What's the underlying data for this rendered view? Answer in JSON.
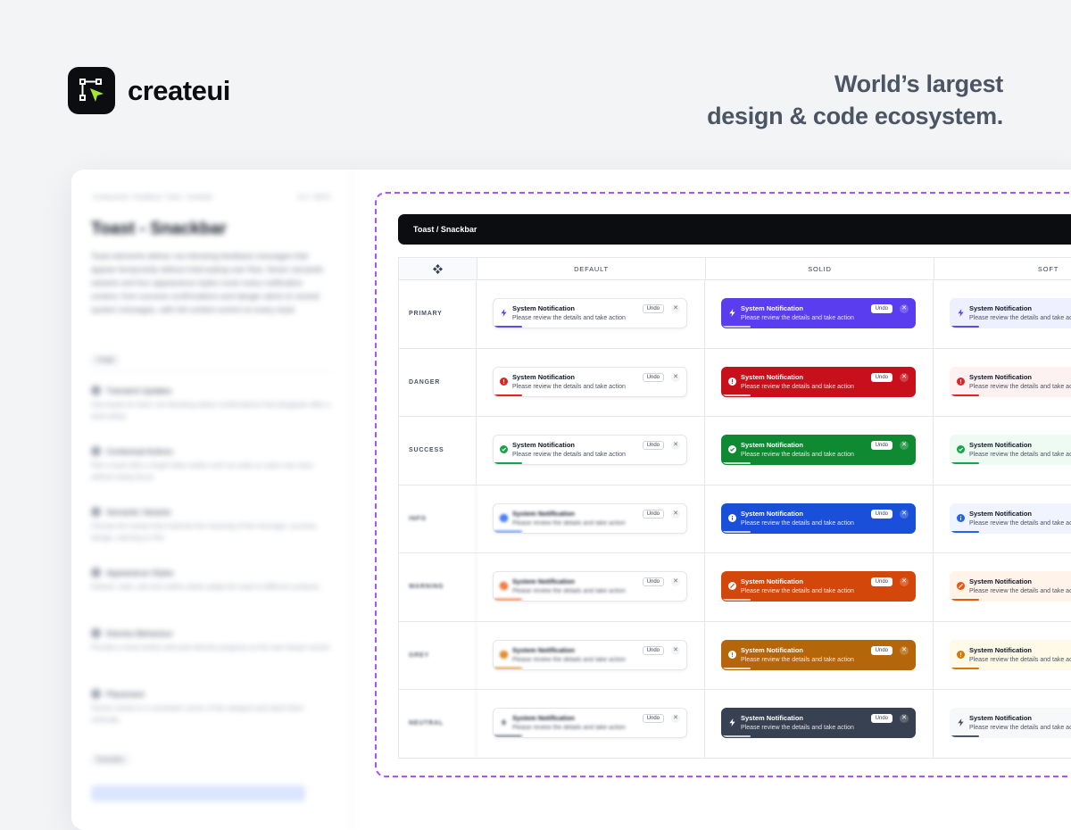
{
  "brand": {
    "name": "createui",
    "tagline_line1": "World’s largest",
    "tagline_line2": "design & code ecosystem."
  },
  "left_panel": {
    "breadcrumb": "Components / Feedback / Toast - Snackbar",
    "version": "v2.0 - BETA",
    "title": "Toast - Snackbar",
    "description": "Toast elements deliver non-blocking feedback messages that appear temporarily without interrupting user flow. Seven semantic variants and four appearance styles cover every notification context, from success confirmations and danger alerts to neutral system messages, with full content control on every toast.",
    "section_tag": "Usage",
    "items": [
      {
        "title": "Transient Updates",
        "text": "Use toasts for brief, non-blocking status confirmations that disappear after a short delay."
      },
      {
        "title": "Contextual Actions",
        "text": "Pair a toast with a single inline action such as undo so users can react without losing focus."
      },
      {
        "title": "Semantic Variants",
        "text": "Choose the variant that matches the meaning of the message: success, danger, warning or info."
      },
      {
        "title": "Appearance Styles",
        "text": "Default, solid, soft and outline styles adapt the toast to different surfaces."
      },
      {
        "title": "Dismiss Behaviour",
        "text": "Provide a close button and auto-dismiss progress so the user keeps control."
      },
      {
        "title": "Placement",
        "text": "Anchor toasts to a consistent corner of the viewport and stack them vertically."
      }
    ],
    "footer_tag": "Examples"
  },
  "frame": {
    "title": "Toast / Snackbar",
    "corner_icon": "component-diamond-icon"
  },
  "columns": [
    "DEFAULT",
    "SOLID",
    "SOFT"
  ],
  "toast": {
    "title": "System Notification",
    "message": "Please review the details and take action",
    "undo": "Undo",
    "close": "✕"
  },
  "rows": [
    {
      "label": "PRIMARY",
      "icon": "bolt-icon",
      "color": "#5b4de8",
      "soft_bg": "#eef0ff",
      "solid": "#5b3df0",
      "blur": false
    },
    {
      "label": "DANGER",
      "icon": "alert-circle-icon",
      "color": "#dc2626",
      "soft_bg": "#fef1f1",
      "solid": "#c8101c",
      "blur": false
    },
    {
      "label": "SUCCESS",
      "icon": "check-circle-icon",
      "color": "#16a34a",
      "soft_bg": "#eefbf2",
      "solid": "#108a32",
      "blur": false
    },
    {
      "label": "INFO",
      "icon": "info-circle-icon",
      "color": "#2563eb",
      "soft_bg": "#eff4ff",
      "solid": "#1a4fd9",
      "blur": true
    },
    {
      "label": "WARNING",
      "icon": "slash-circle-icon",
      "color": "#ea580c",
      "soft_bg": "#fff3ea",
      "solid": "#d3470a",
      "blur": true
    },
    {
      "label": "GREY",
      "icon": "alert-circle-icon",
      "color": "#d97706",
      "soft_bg": "#fffae8",
      "solid": "#b5650a",
      "blur": true
    },
    {
      "label": "NEUTRAL",
      "icon": "bolt-icon",
      "color": "#4b5563",
      "soft_bg": "#f7f8fa",
      "solid": "#374151",
      "blur": true
    }
  ]
}
